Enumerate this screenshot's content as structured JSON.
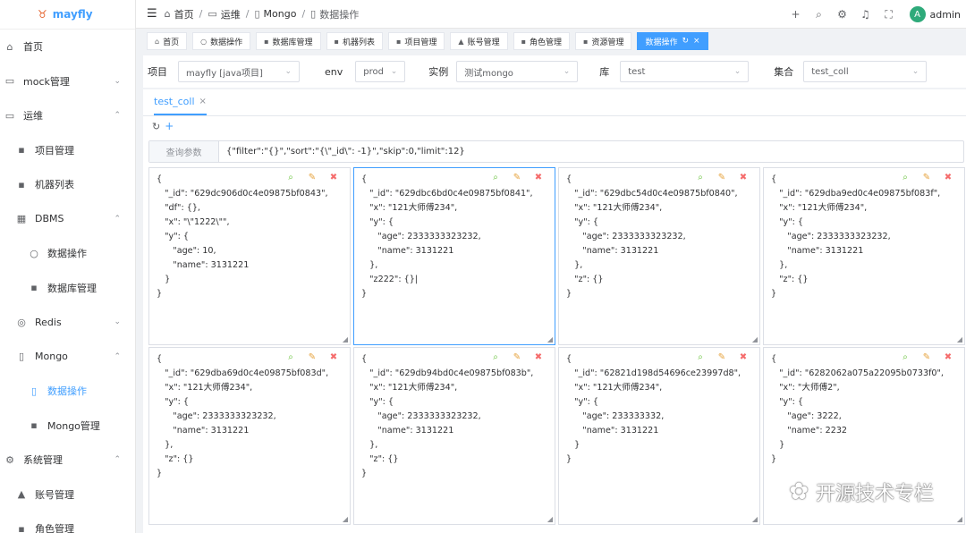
{
  "app": {
    "logo_text": "mayfly"
  },
  "sidebar": {
    "items": [
      {
        "label": "首页",
        "icon": "home-icon",
        "glyph": "⌂",
        "level": 1
      },
      {
        "label": "mock管理",
        "icon": "mock-icon",
        "glyph": "▭",
        "level": 1,
        "chevron": "⌄"
      },
      {
        "label": "运维",
        "icon": "monitor-icon",
        "glyph": "▭",
        "level": 1,
        "chevron": "⌃"
      },
      {
        "label": "项目管理",
        "icon": "grid-icon",
        "glyph": "▪",
        "level": 2
      },
      {
        "label": "机器列表",
        "icon": "grid-icon",
        "glyph": "▪",
        "level": 2
      },
      {
        "label": "DBMS",
        "icon": "table-icon",
        "glyph": "▦",
        "level": 2,
        "chevron": "⌃"
      },
      {
        "label": "数据操作",
        "icon": "search-icon",
        "glyph": "○",
        "level": 3
      },
      {
        "label": "数据库管理",
        "icon": "grid-icon",
        "glyph": "▪",
        "level": 3
      },
      {
        "label": "Redis",
        "icon": "database-icon",
        "glyph": "◎",
        "level": 2,
        "chevron": "⌄"
      },
      {
        "label": "Mongo",
        "icon": "document-icon",
        "glyph": "▯",
        "level": 2,
        "chevron": "⌃"
      },
      {
        "label": "数据操作",
        "icon": "document-icon",
        "glyph": "▯",
        "level": 3,
        "active": true
      },
      {
        "label": "Mongo管理",
        "icon": "grid-icon",
        "glyph": "▪",
        "level": 3
      },
      {
        "label": "系统管理",
        "icon": "gear-icon",
        "glyph": "⚙",
        "level": 1,
        "chevron": "⌃"
      },
      {
        "label": "账号管理",
        "icon": "user-icon",
        "glyph": "▲",
        "level": 2
      },
      {
        "label": "角色管理",
        "icon": "grid-icon",
        "glyph": "▪",
        "level": 2
      }
    ]
  },
  "header": {
    "breadcrumbs": [
      {
        "label": "首页",
        "icon": "home-icon",
        "glyph": "⌂"
      },
      {
        "label": "运维",
        "icon": "monitor-icon",
        "glyph": "▭"
      },
      {
        "label": "Mongo",
        "icon": "document-icon",
        "glyph": "▯"
      },
      {
        "label": "数据操作",
        "icon": "document-icon",
        "glyph": "▯"
      }
    ],
    "separator": "/",
    "user": {
      "avatar_letter": "A",
      "name": "admin"
    }
  },
  "tags": [
    {
      "label": "首页",
      "icon": "home-icon",
      "glyph": "⌂"
    },
    {
      "label": "数据操作",
      "icon": "search-icon",
      "glyph": "○"
    },
    {
      "label": "数据库管理",
      "icon": "grid-icon",
      "glyph": "▪"
    },
    {
      "label": "机器列表",
      "icon": "grid-icon",
      "glyph": "▪"
    },
    {
      "label": "项目管理",
      "icon": "grid-icon",
      "glyph": "▪"
    },
    {
      "label": "账号管理",
      "icon": "user-icon",
      "glyph": "▲"
    },
    {
      "label": "角色管理",
      "icon": "grid-icon",
      "glyph": "▪"
    },
    {
      "label": "资源管理",
      "icon": "grid-icon",
      "glyph": "▪"
    },
    {
      "label": "数据操作",
      "active": true,
      "refresh": "↻",
      "close": "×"
    }
  ],
  "filters": {
    "project_label": "项目",
    "project_value": "mayfly [java项目]",
    "env_label": "env",
    "env_value": "prod",
    "instance_label": "实例",
    "instance_value": "测试mongo",
    "db_label": "库",
    "db_value": "test",
    "coll_label": "集合",
    "coll_value": "test_coll"
  },
  "collection_tab": {
    "label": "test_coll",
    "close": "×"
  },
  "toolbar": {
    "refresh": "↻",
    "add": "+"
  },
  "query": {
    "label": "查询参数",
    "value": "{\"filter\":\"{}\",\"sort\":\"{\\\"_id\\\": -1}\",\"skip\":0,\"limit\":12}"
  },
  "documents": [
    "{\n   \"_id\": \"629dc906d0c4e09875bf0843\",\n   \"df\": {},\n   \"x\": \"\\\"1222\\\"\",\n   \"y\": {\n      \"age\": 10,\n      \"name\": 3131221\n   }\n}",
    "{\n   \"_id\": \"629dbc6bd0c4e09875bf0841\",\n   \"x\": \"121大师傅234\",\n   \"y\": {\n      \"age\": 2333333323232,\n      \"name\": 3131221\n   },\n   \"z222\": {}|\n}",
    "{\n   \"_id\": \"629dbc54d0c4e09875bf0840\",\n   \"x\": \"121大师傅234\",\n   \"y\": {\n      \"age\": 2333333323232,\n      \"name\": 3131221\n   },\n   \"z\": {}\n}",
    "{\n   \"_id\": \"629dba9ed0c4e09875bf083f\",\n   \"x\": \"121大师傅234\",\n   \"y\": {\n      \"age\": 2333333323232,\n      \"name\": 3131221\n   },\n   \"z\": {}\n}",
    "{\n   \"_id\": \"629dba69d0c4e09875bf083d\",\n   \"x\": \"121大师傅234\",\n   \"y\": {\n      \"age\": 2333333323232,\n      \"name\": 3131221\n   },\n   \"z\": {}\n}",
    "{\n   \"_id\": \"629db94bd0c4e09875bf083b\",\n   \"x\": \"121大师傅234\",\n   \"y\": {\n      \"age\": 2333333323232,\n      \"name\": 3131221\n   },\n   \"z\": {}\n}",
    "{\n   \"_id\": \"62821d198d54696ce23997d8\",\n   \"x\": \"121大师傅234\",\n   \"y\": {\n      \"age\": 233333332,\n      \"name\": 3131221\n   }\n}",
    "{\n   \"_id\": \"6282062a075a22095b0733f0\",\n   \"x\": \"大师傅2\",\n   \"y\": {\n      \"age\": 3222,\n      \"name\": 2232\n   }\n}"
  ],
  "doc_tools": {
    "search": "⌕",
    "edit": "✎",
    "delete": "✖"
  },
  "watermark": {
    "text": "开源技术专栏"
  }
}
